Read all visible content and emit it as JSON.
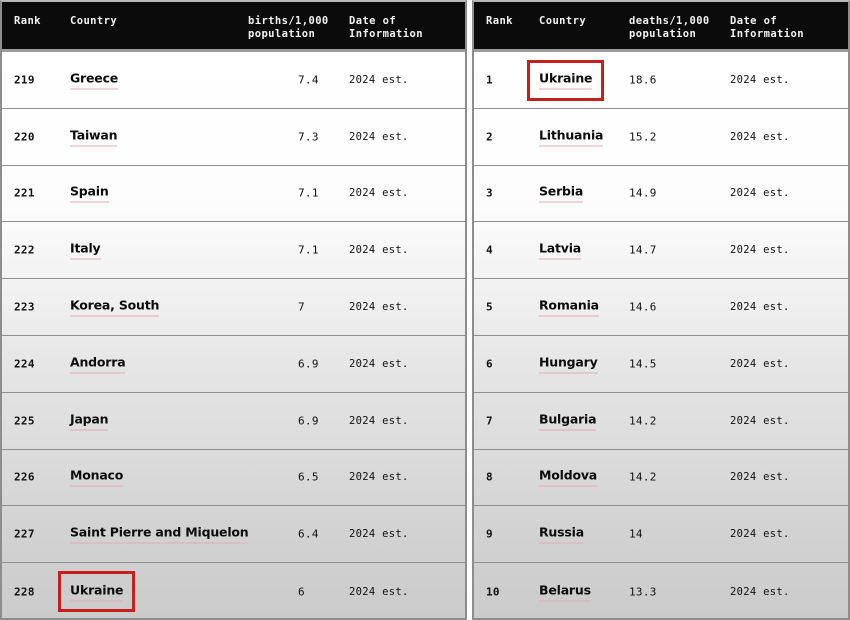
{
  "left_table": {
    "name": "birth-rate-ranking",
    "headers": {
      "rank": "Rank",
      "country": "Country",
      "metric": "births/1,000\npopulation",
      "date": "Date of\nInformation"
    },
    "highlight_color": "#c4201f",
    "rows": [
      {
        "rank": "219",
        "country": "Greece",
        "value": "7.4",
        "date": "2024 est.",
        "highlight": false
      },
      {
        "rank": "220",
        "country": "Taiwan",
        "value": "7.3",
        "date": "2024 est.",
        "highlight": false
      },
      {
        "rank": "221",
        "country": "Spain",
        "value": "7.1",
        "date": "2024 est.",
        "highlight": false
      },
      {
        "rank": "222",
        "country": "Italy",
        "value": "7.1",
        "date": "2024 est.",
        "highlight": false
      },
      {
        "rank": "223",
        "country": "Korea, South",
        "value": "7",
        "date": "2024 est.",
        "highlight": false
      },
      {
        "rank": "224",
        "country": "Andorra",
        "value": "6.9",
        "date": "2024 est.",
        "highlight": false
      },
      {
        "rank": "225",
        "country": "Japan",
        "value": "6.9",
        "date": "2024 est.",
        "highlight": false
      },
      {
        "rank": "226",
        "country": "Monaco",
        "value": "6.5",
        "date": "2024 est.",
        "highlight": false
      },
      {
        "rank": "227",
        "country": "Saint Pierre and Miquelon",
        "value": "6.4",
        "date": "2024 est.",
        "highlight": false
      },
      {
        "rank": "228",
        "country": "Ukraine",
        "value": "6",
        "date": "2024 est.",
        "highlight": true
      }
    ]
  },
  "right_table": {
    "name": "death-rate-ranking",
    "headers": {
      "rank": "Rank",
      "country": "Country",
      "metric": "deaths/1,000\npopulation",
      "date": "Date of\nInformation"
    },
    "highlight_color": "#c4201f",
    "rows": [
      {
        "rank": "1",
        "country": "Ukraine",
        "value": "18.6",
        "date": "2024 est.",
        "highlight": true
      },
      {
        "rank": "2",
        "country": "Lithuania",
        "value": "15.2",
        "date": "2024 est.",
        "highlight": false
      },
      {
        "rank": "3",
        "country": "Serbia",
        "value": "14.9",
        "date": "2024 est.",
        "highlight": false
      },
      {
        "rank": "4",
        "country": "Latvia",
        "value": "14.7",
        "date": "2024 est.",
        "highlight": false
      },
      {
        "rank": "5",
        "country": "Romania",
        "value": "14.6",
        "date": "2024 est.",
        "highlight": false
      },
      {
        "rank": "6",
        "country": "Hungary",
        "value": "14.5",
        "date": "2024 est.",
        "highlight": false
      },
      {
        "rank": "7",
        "country": "Bulgaria",
        "value": "14.2",
        "date": "2024 est.",
        "highlight": false
      },
      {
        "rank": "8",
        "country": "Moldova",
        "value": "14.2",
        "date": "2024 est.",
        "highlight": false
      },
      {
        "rank": "9",
        "country": "Russia",
        "value": "14",
        "date": "2024 est.",
        "highlight": false
      },
      {
        "rank": "10",
        "country": "Belarus",
        "value": "13.3",
        "date": "2024 est.",
        "highlight": false
      }
    ]
  }
}
